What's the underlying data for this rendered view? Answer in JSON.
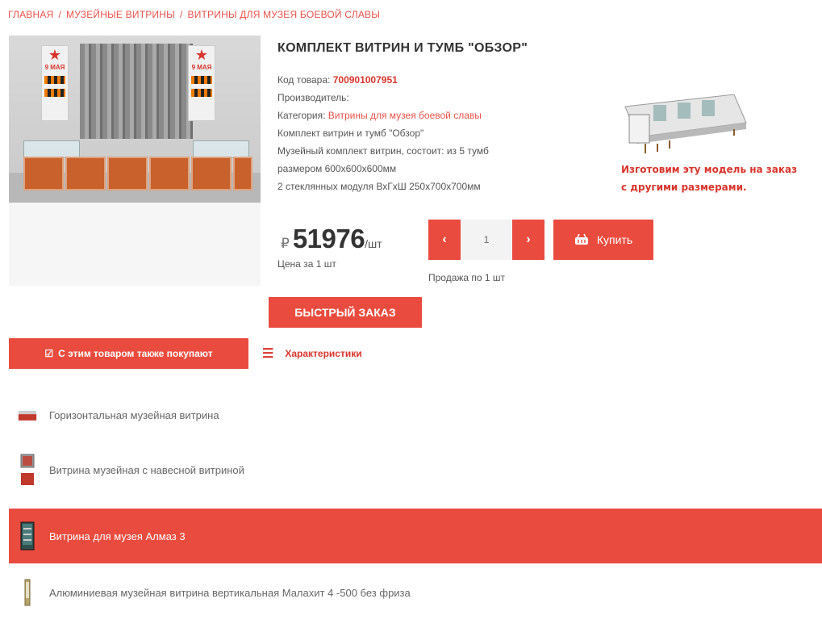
{
  "breadcrumb": {
    "items": [
      "ГЛАВНАЯ",
      "МУЗЕЙНЫЕ ВИТРИНЫ",
      "ВИТРИНЫ ДЛЯ МУЗЕЯ БОЕВОЙ СЛАВЫ"
    ],
    "separator": "/"
  },
  "product": {
    "title": "КОМПЛЕКТ ВИТРИН И ТУМБ \"ОБЗОР\"",
    "code_label": "Код товара:",
    "code_value": "700901007951",
    "manufacturer_label": "Производитель:",
    "category_label": "Категория:",
    "category_value": "Витрины для музея боевой славы",
    "desc_lines": [
      "Комплект витрин и тумб \"Обзор\"",
      "Музейный комплект витрин, состоит: из 5 тумб",
      "размером 600х600х600мм",
      "2 стеклянных модуля ВхГхШ 250х700х700мм"
    ]
  },
  "banner_photo": {
    "left_banner_text": "9 МАЯ",
    "right_banner_text": "9 МАЯ"
  },
  "promo": {
    "line1": "Изготовим эту модель на заказ",
    "line2": "с другими размерами."
  },
  "price": {
    "currency": "₽",
    "value": "51976",
    "unit": "/шт",
    "per_label": "Цена за 1 шт"
  },
  "quantity": {
    "minus_label": "‹",
    "plus_label": "›",
    "value": "1",
    "sale_label": "Продажа по 1 шт"
  },
  "buttons": {
    "buy_label": "Купить",
    "quick_order_label": "БЫСТРЫЙ ЗАКАЗ"
  },
  "tabs": {
    "also_buy": "С этим товаром также покупают",
    "characteristics": "Характеристики"
  },
  "related": [
    {
      "label": "Горизонтальная музейная витрина",
      "active": false,
      "thumb": "horizontal-showcase-thumb"
    },
    {
      "label": "Витрина музейная с навесной витриной",
      "active": false,
      "thumb": "hanging-showcase-thumb"
    },
    {
      "label": "Витрина для музея Алмаз 3",
      "active": true,
      "thumb": "almaz-showcase-thumb"
    },
    {
      "label": "Алюминиевая музейная витрина вертикальная Малахит 4 -500 без фриза",
      "active": false,
      "thumb": "vertical-showcase-thumb"
    }
  ],
  "colors": {
    "accent": "#ea4b3f",
    "accent_text": "#d8352c"
  }
}
